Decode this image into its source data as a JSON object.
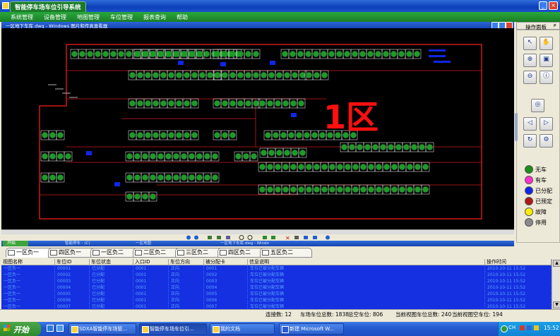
{
  "window": {
    "title": "智能停车场车位引导系统",
    "minimize": "_",
    "close": "×"
  },
  "menu": [
    "系统管理",
    "设备管理",
    "地图管理",
    "车位管理",
    "报表查询",
    "帮助"
  ],
  "map_window": {
    "title": "一区地下车库.dwg - Windows 图片和传真查看器"
  },
  "map": {
    "zone_label": "1区",
    "colors": {
      "background": "#000000",
      "space_free": "#1f9a2a",
      "space_border": "#ffffff",
      "wall": "#d01818",
      "zone_text": "#ff1010"
    }
  },
  "map_taskbar": {
    "items": [
      "开始",
      "智能停车 - (C)",
      "一区地图",
      "一区地下车库.dwg - Windo"
    ]
  },
  "panel": {
    "title": "操作面板",
    "pin": "ᴘ",
    "tools": [
      "pointer-icon",
      "hand-icon",
      "zoom-in-icon",
      "zoom-out-icon",
      "zoom-fit-icon",
      "info-icon",
      "locate-icon",
      "prev-icon",
      "next-icon",
      "refresh-icon",
      "settings-icon"
    ],
    "legend": [
      {
        "label": "无车",
        "color": "#1a8f1a"
      },
      {
        "label": "有车",
        "color": "#ff2fd0"
      },
      {
        "label": "已分配",
        "color": "#1026e8"
      },
      {
        "label": "已预定",
        "color": "#b01818"
      },
      {
        "label": "故障",
        "color": "#ffee00"
      },
      {
        "label": "停用",
        "color": "#8a8a8a"
      }
    ]
  },
  "tabs": [
    "一区负一",
    "四区负一",
    "一区负二",
    "二区负二",
    "三区负二",
    "四区负二",
    "五区负二"
  ],
  "table": {
    "columns": [
      "视图名称",
      "车位ID",
      "车位状态",
      "入口ID",
      "车位方向",
      "被分配卡",
      "信息说明",
      "操作时间"
    ],
    "rows": [
      [
        "一区负一",
        "00001",
        "已分配",
        "0001",
        "正向",
        "0001",
        "车位已被分配车辆",
        "2010-10-11 15:52"
      ],
      [
        "一区负一",
        "00002",
        "已分配",
        "0001",
        "正向",
        "0002",
        "车位已被分配车辆",
        "2010-10-11 15:52"
      ],
      [
        "一区负一",
        "00003",
        "已分配",
        "0001",
        "正向",
        "0003",
        "车位已被分配车辆",
        "2010-10-11 15:52"
      ],
      [
        "一区负一",
        "00004",
        "已分配",
        "0001",
        "正向",
        "0004",
        "车位已被分配车辆",
        "2010-10-11 15:52"
      ],
      [
        "一区负一",
        "00005",
        "已分配",
        "0001",
        "正向",
        "0005",
        "车位已被分配车辆",
        "2010-10-11 15:52"
      ],
      [
        "一区负一",
        "00006",
        "已分配",
        "0001",
        "正向",
        "0006",
        "车位已被分配车辆",
        "2010-10-11 15:52"
      ],
      [
        "一区负一",
        "00007",
        "已分配",
        "0001",
        "正向",
        "0007",
        "车位已被分配车辆",
        "2010-10-11 15:52"
      ]
    ]
  },
  "status": {
    "connections": "连接数: 12",
    "total": "车场车位总数: 1838",
    "empty_total": "总空车位: 806",
    "view_total": "当前视图车位总数: 240",
    "view_empty": "当前视图空车位: 194"
  },
  "taskbar": {
    "start": "开始",
    "items": [
      "SDXA智能停车场管...",
      "智能停车场车位引...",
      "我的文档",
      "新建 Microsoft W..."
    ],
    "tray": {
      "lang": "CH",
      "time": "15:52"
    }
  }
}
